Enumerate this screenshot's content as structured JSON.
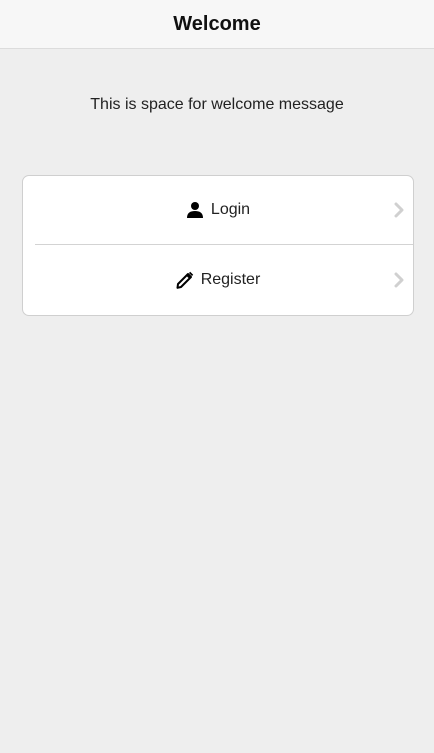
{
  "header": {
    "title": "Welcome"
  },
  "main": {
    "welcome_message": "This is space for welcome message",
    "menu": {
      "items": [
        {
          "label": "Login",
          "icon": "user-icon"
        },
        {
          "label": "Register",
          "icon": "pencil-icon"
        }
      ],
      "chevron_icon": "chevron-right-icon"
    }
  },
  "colors": {
    "background": "#eeeeee",
    "header_background": "#f7f7f7",
    "card_background": "#ffffff",
    "text": "#222222",
    "chevron": "#d0d0d0"
  }
}
